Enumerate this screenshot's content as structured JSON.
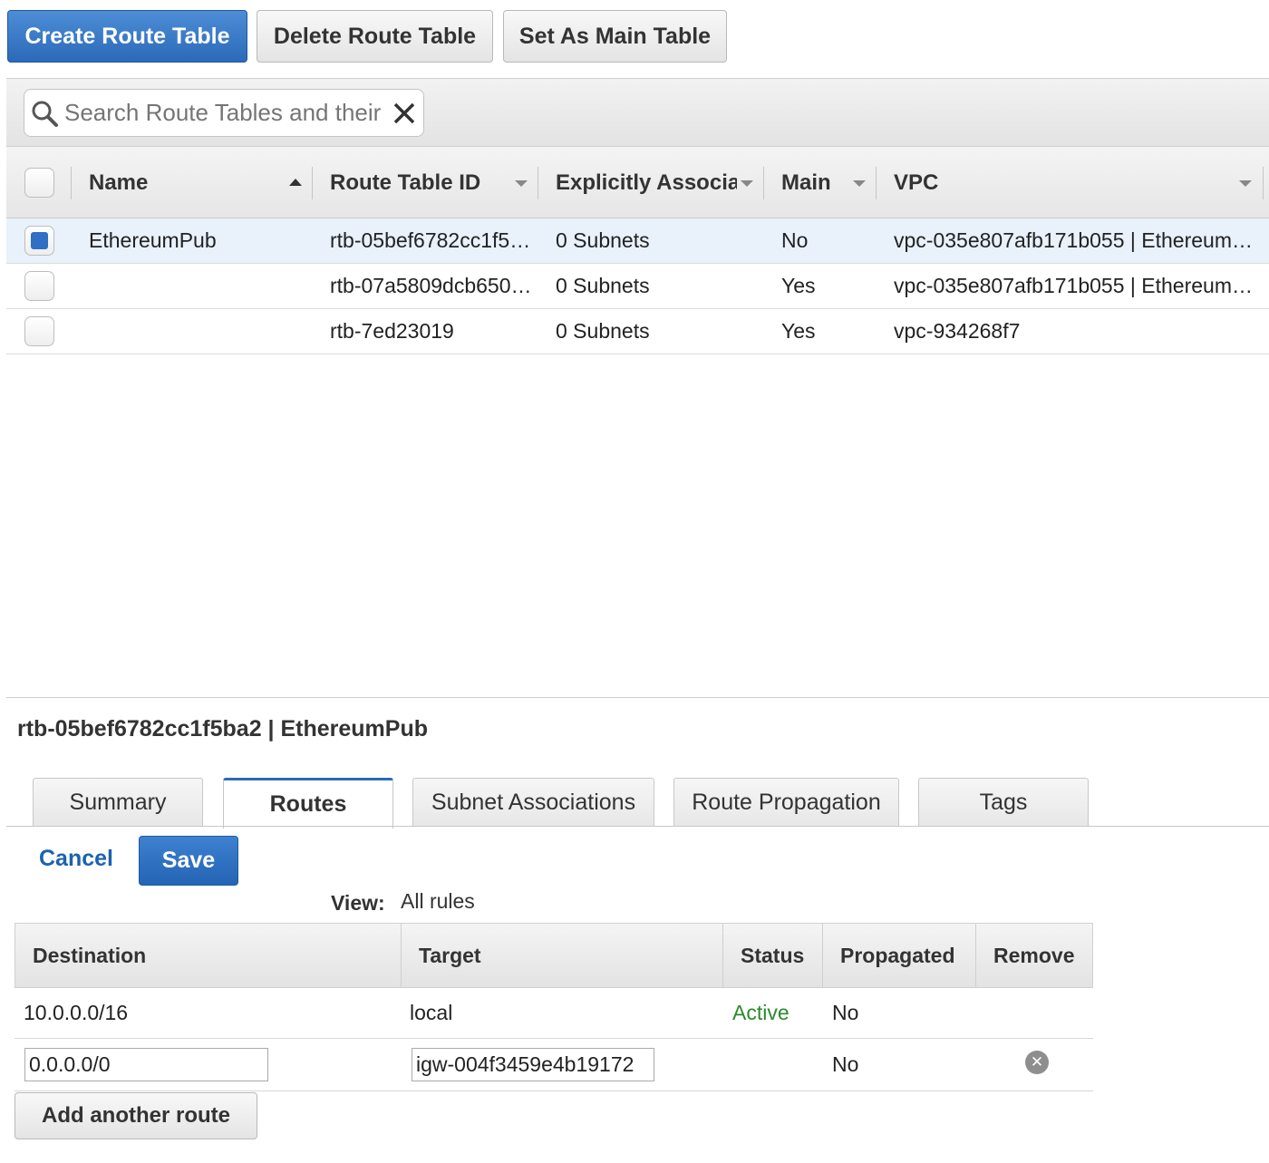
{
  "toolbar": {
    "create_label": "Create Route Table",
    "delete_label": "Delete Route Table",
    "main_label": "Set As Main Table"
  },
  "search": {
    "placeholder": "Search Route Tables and their"
  },
  "table": {
    "columns": {
      "name": "Name",
      "route_table_id": "Route Table ID",
      "explicitly_associated": "Explicitly Associat",
      "main": "Main",
      "vpc": "VPC"
    },
    "rows": [
      {
        "selected": true,
        "name": "EthereumPub",
        "route_table_id": "rtb-05bef6782cc1f5…",
        "explicitly_associated": "0 Subnets",
        "main": "No",
        "vpc": "vpc-035e807afb171b055 | Ethereum…"
      },
      {
        "selected": false,
        "name": "",
        "route_table_id": "rtb-07a5809dcb650…",
        "explicitly_associated": "0 Subnets",
        "main": "Yes",
        "vpc": "vpc-035e807afb171b055 | Ethereum…"
      },
      {
        "selected": false,
        "name": "",
        "route_table_id": "rtb-7ed23019",
        "explicitly_associated": "0 Subnets",
        "main": "Yes",
        "vpc": "vpc-934268f7"
      }
    ]
  },
  "detail": {
    "title": "rtb-05bef6782cc1f5ba2 | EthereumPub",
    "tabs": [
      {
        "label": "Summary",
        "active": false
      },
      {
        "label": "Routes",
        "active": true
      },
      {
        "label": "Subnet Associations",
        "active": false
      },
      {
        "label": "Route Propagation",
        "active": false
      },
      {
        "label": "Tags",
        "active": false
      }
    ],
    "cancel_label": "Cancel",
    "save_label": "Save",
    "view_label": "View:",
    "view_value": "All rules"
  },
  "routes": {
    "columns": {
      "destination": "Destination",
      "target": "Target",
      "status": "Status",
      "propagated": "Propagated",
      "remove": "Remove"
    },
    "rows": [
      {
        "destination": "10.0.0.0/16",
        "target": "local",
        "status": "Active",
        "propagated": "No"
      },
      {
        "destination": "0.0.0.0/0",
        "target": "igw-004f3459e4b19172",
        "status": "",
        "propagated": "No"
      }
    ],
    "add_label": "Add another route"
  },
  "colors": {
    "primary_blue": "#2a6ab8",
    "status_active": "#2b8a2b",
    "selected_row": "#e9f1fb"
  },
  "icons": [
    "search-icon",
    "clear-icon",
    "sort-asc-icon",
    "sort-desc-icon",
    "remove-icon"
  ]
}
